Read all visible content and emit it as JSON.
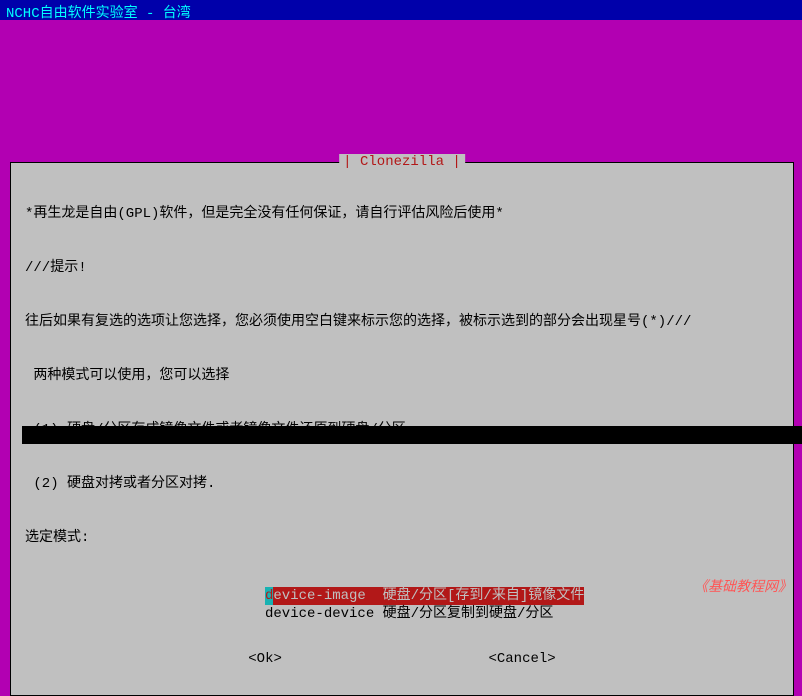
{
  "header": {
    "title": "NCHC自由软件实验室 - 台湾"
  },
  "dialog": {
    "title": "Clonezilla",
    "line1": "*再生龙是自由(GPL)软件，但是完全没有任何保证，请自行评估风险后使用*",
    "line2": "///提示!",
    "line3": "往后如果有复选的选项让您选择，您必须使用空白键来标示您的选择，被标示选到的部分会出现星号(*)///",
    "line4": " 两种模式可以使用，您可以选择",
    "line5": " (1) 硬盘/分区存成镜像文件或者镜像文件还原到硬盘/分区，",
    "line6": " (2) 硬盘对拷或者分区对拷.",
    "line7": "选定模式:",
    "options": [
      {
        "letter": "d",
        "rest": "evice-image  硬盘/分区[存到/来自]镜像文件",
        "selected": true
      },
      {
        "letter": "d",
        "rest": "evice-device 硬盘/分区复制到硬盘/分区",
        "selected": false
      }
    ],
    "buttons": {
      "ok": "<Ok>",
      "cancel": "<Cancel>"
    }
  },
  "footer": {
    "text": "《基础教程网》"
  }
}
